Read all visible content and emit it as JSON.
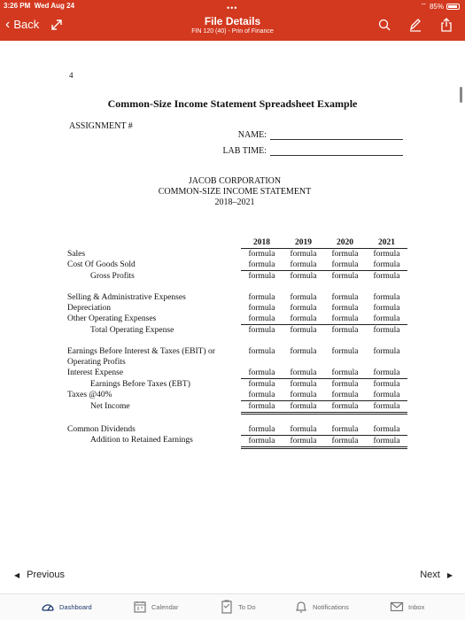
{
  "status": {
    "time": "3:26 PM",
    "day": "Wed Aug 24",
    "battery": "85%"
  },
  "header": {
    "back_label": "Back",
    "title": "File Details",
    "subtitle": "FIN 120 (40) - Prin of Finance",
    "icons": [
      "expand-icon",
      "search-icon",
      "pencil-icon",
      "share-icon"
    ],
    "bg_color": "#d3391f"
  },
  "document": {
    "page_number": "4",
    "title": "Common-Size Income Statement Spreadsheet Example",
    "assignment_label": "ASSIGNMENT #",
    "name_label": "NAME:",
    "lab_time_label": "LAB TIME:",
    "company": "JACOB CORPORATION",
    "statement": "COMMON-SIZE INCOME STATEMENT",
    "period": "2018–2021",
    "years": [
      "2018",
      "2019",
      "2020",
      "2021"
    ],
    "cell_value": "formula",
    "rows": [
      {
        "label": "Sales"
      },
      {
        "label": "Cost Of Goods Sold"
      },
      {
        "label": "Gross Profits"
      },
      {
        "label": "Selling & Administrative Expenses"
      },
      {
        "label": "Depreciation"
      },
      {
        "label": "Other Operating Expenses"
      },
      {
        "label": "Total Operating Expense"
      },
      {
        "label_line1": "Earnings Before Interest & Taxes (EBIT) or",
        "label_line2": "Operating Profits"
      },
      {
        "label": "Interest Expense"
      },
      {
        "label": "Earnings Before Taxes (EBT)"
      },
      {
        "label": "Taxes @40%"
      },
      {
        "label": "Net Income"
      },
      {
        "label": "Common Dividends"
      },
      {
        "label": "Addition to Retained Earnings"
      }
    ]
  },
  "footer": {
    "previous_label": "Previous",
    "next_label": "Next",
    "tabs": [
      {
        "label": "Dashboard",
        "icon": "dashboard-icon"
      },
      {
        "label": "Calendar",
        "icon": "calendar-icon"
      },
      {
        "label": "To Do",
        "icon": "todo-icon"
      },
      {
        "label": "Notifications",
        "icon": "bell-icon"
      },
      {
        "label": "Inbox",
        "icon": "inbox-icon"
      }
    ]
  }
}
